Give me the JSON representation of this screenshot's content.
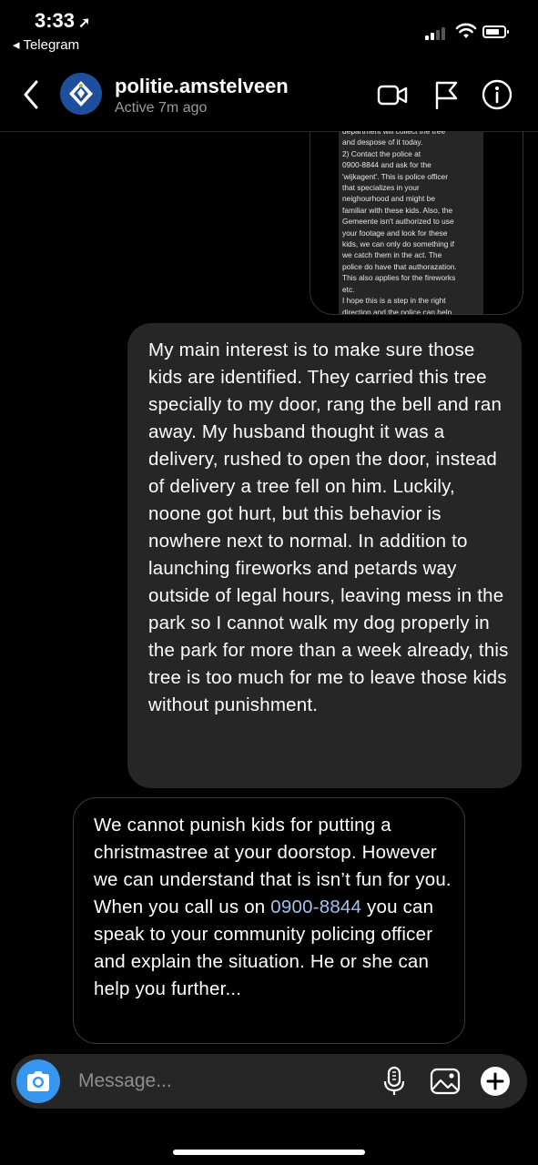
{
  "status_bar": {
    "time": "3:33",
    "back_app": "Telegram"
  },
  "header": {
    "username": "politie.amstelveen",
    "status": "Active 7m ago"
  },
  "snippet": {
    "text": "department will collect the tree\nand despose of it today.\n2) Contact the police at\n0900-8844 and ask for the\n'wijkagent'. This is police officer\nthat specializes in your\nneighourhood and might be\nfamiliar with these kids. Also, the\nGemeente isn't authorized to use\nyour footage and look for these\nkids, we can only do something if\nwe catch them in the act. The\npolice do have that authorazation.\nThis also applies for the fireworks\netc.\nI hope this is a step in the right\ndirection and the police can help"
  },
  "messages": {
    "outgoing": "My main interest is to make sure those kids are identified. They carried this tree specially to my door, rang the bell and ran away. My husband thought it was a delivery, rushed to open the door, instead of delivery a tree fell on him. Luckily, noone got hurt, but this behavior is nowhere next to normal. In addition to launching fireworks and petards way outside of legal hours, leaving mess in the park so I cannot walk my dog properly in the park for more than a week already, this tree is too much for me to leave those kids without punishment.",
    "incoming_part1": "We cannot punish kids for putting a christmastree at your doorstop. However we can understand that is isn’t fun for you. When you call us on ",
    "incoming_phone": "0900-8844",
    "incoming_part2": " you can speak to your community policing officer and explain the situation. He or she can help you further..."
  },
  "composer": {
    "placeholder": "Message..."
  },
  "icons": {
    "back": "chevron-left-icon",
    "video": "video-camera-icon",
    "flag": "flag-icon",
    "info": "info-icon",
    "camera": "camera-icon",
    "mic": "microphone-icon",
    "gallery": "image-icon",
    "plus": "plus-icon"
  },
  "colors": {
    "accent": "#3797f0",
    "bubble_out": "#262626",
    "phone_link": "#9fc1ea",
    "avatar": "#1e4f9c"
  }
}
